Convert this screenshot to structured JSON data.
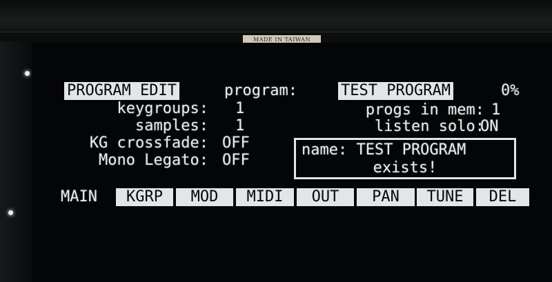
{
  "hardware": {
    "made_label": "MADE IN TAIWAN"
  },
  "header": {
    "mode": "PROGRAM EDIT",
    "program_label": "program:",
    "program_name": "TEST PROGRAM",
    "percent": "0%"
  },
  "fields": {
    "keygroups_label": "keygroups:",
    "keygroups_value": "1",
    "samples_label": "samples:",
    "samples_value": "1",
    "crossfade_label": "KG crossfade:",
    "crossfade_value": "OFF",
    "legato_label": "Mono Legato:",
    "legato_value": "OFF",
    "progs_label": "progs in mem:",
    "progs_value": "1",
    "solo_label": "listen solo:",
    "solo_value": "ON"
  },
  "message": {
    "line1": "name: TEST PROGRAM",
    "line2": "exists!"
  },
  "soft_keys": [
    {
      "label": "MAIN"
    },
    {
      "label": "KGRP"
    },
    {
      "label": "MOD"
    },
    {
      "label": "MIDI"
    },
    {
      "label": "OUT"
    },
    {
      "label": "PAN"
    },
    {
      "label": "TUNE"
    },
    {
      "label": "DEL"
    }
  ]
}
